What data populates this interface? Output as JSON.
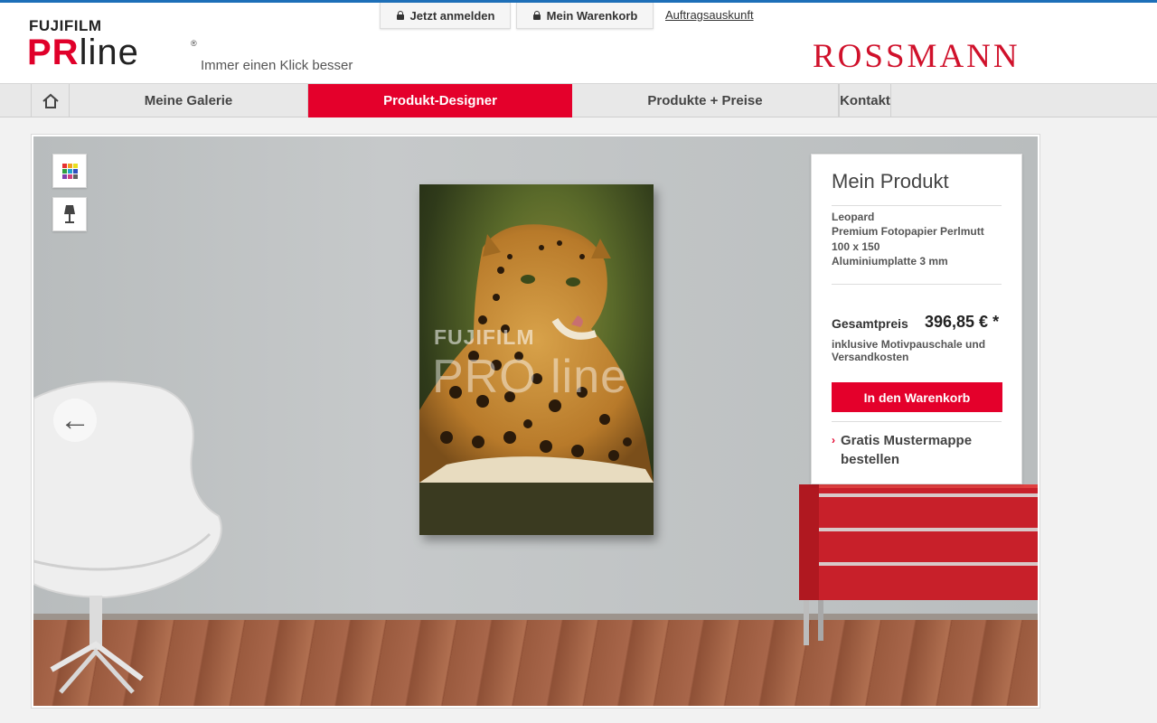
{
  "header": {
    "brand_top": "FUJIFILM",
    "brand_pro": "PR",
    "brand_line": "line",
    "brand_reg": "®",
    "tagline": "Immer einen Klick besser",
    "login_label": "Jetzt anmelden",
    "cart_label": "Mein Warenkorb",
    "order_info_link": "Auftragsauskunft",
    "partner_logo": "ROSSMANN"
  },
  "nav": {
    "home_icon": "home-icon",
    "items": [
      {
        "label": "Meine Galerie"
      },
      {
        "label": "Produkt-Designer"
      },
      {
        "label": "Produkte + Preise"
      },
      {
        "label": "Kontakt"
      }
    ],
    "active_index": 1
  },
  "stage": {
    "tools": [
      "color-palette-icon",
      "lamp-icon"
    ],
    "nav_arrow": "←",
    "watermark_top": "FUJIFILM",
    "watermark_bottom": "PRO line"
  },
  "product": {
    "title": "Mein Produkt",
    "motif": "Leopard",
    "paper": "Premium Fotopapier Perlmutt",
    "size": "100 x 150",
    "mount": "Aluminiumplatte 3 mm",
    "total_label": "Gesamtpreis",
    "total_price": "396,85 € *",
    "total_note": "inklusive Motivpauschale und Versandkosten",
    "add_to_cart": "In den Warenkorb",
    "sample_link": "Gratis Mustermappe bestellen",
    "sample_caret": "›"
  },
  "colors": {
    "brand_red": "#e4002b",
    "rossmann_red": "#d0112b",
    "top_line_blue": "#1d6fb8"
  }
}
